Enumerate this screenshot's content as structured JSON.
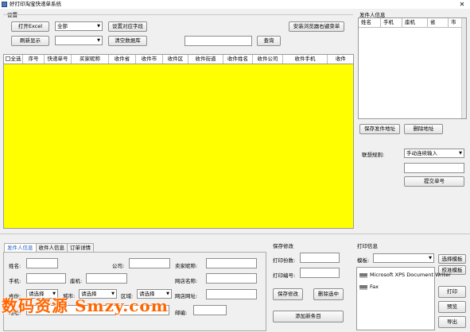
{
  "window": {
    "title": "好打印淘宝快递单系统",
    "close": "✕"
  },
  "settings": {
    "group_label": "设置",
    "open_excel": "打开Excel",
    "filter_select": "全部",
    "set_fields": "设置对应字段",
    "install_menu": "安装浏览器右键菜单",
    "refresh": "刷新显示",
    "select2": "",
    "clear_db": "清空数据库",
    "search_value": "",
    "query": "查询"
  },
  "grid": {
    "columns": [
      "全选",
      "序号",
      "快递单号",
      "买家昵称",
      "收件省",
      "收件市",
      "收件区",
      "收件街道",
      "收件姓名",
      "收件公司",
      "收件手机",
      "收件"
    ]
  },
  "sender_panel": {
    "group_label": "发件人信息",
    "columns": [
      "姓名",
      "手机",
      "座机",
      "省",
      "市"
    ],
    "save_btn": "保存发件地址",
    "delete_btn": "删除地址",
    "rule_label": "联想规则:",
    "rule_select": "手动连续输入",
    "input_value": "",
    "submit_btn": "提交单号"
  },
  "tabs": [
    "发件人信息",
    "收件人信息",
    "订单详情"
  ],
  "form": {
    "name": "姓名:",
    "company": "公司:",
    "seller_nick": "卖家昵称:",
    "mobile": "手机:",
    "phone": "座机:",
    "shop_name": "网店名称:",
    "province": "省份:",
    "province_sel": "请选择",
    "city": "城市:",
    "city_sel": "请选择",
    "district": "区域:",
    "district_sel": "请选择",
    "shop_url": "网店网址:",
    "address": "地址:",
    "postcode": "邮编:"
  },
  "save_panel": {
    "group_label": "保存修改",
    "print_count": "打印份数:",
    "print_no": "打印编号:",
    "save_btn": "保存修改",
    "delete_btn": "删除选中",
    "add_btn": "添加新条目"
  },
  "print_panel": {
    "group_label": "打印信息",
    "template_label": "模板:",
    "template_sel": "",
    "select_template": "选择模板",
    "calibrate": "校准模板",
    "printers": [
      "Microsoft XPS Document Writer",
      "Fax"
    ],
    "print": "打印",
    "preview": "预览",
    "export": "导出"
  },
  "watermark": "数码资源 Smzy.com"
}
